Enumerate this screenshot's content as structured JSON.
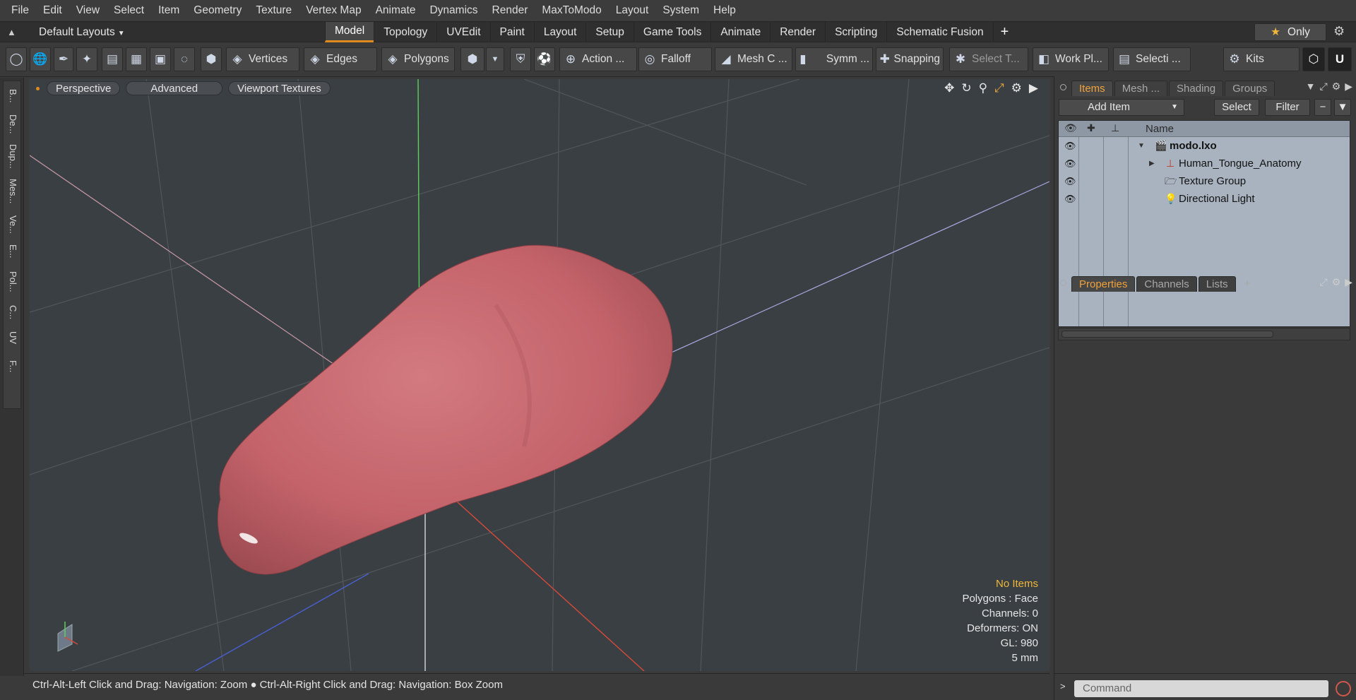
{
  "menu": [
    "File",
    "Edit",
    "View",
    "Select",
    "Item",
    "Geometry",
    "Texture",
    "Vertex Map",
    "Animate",
    "Dynamics",
    "Render",
    "MaxToModo",
    "Layout",
    "System",
    "Help"
  ],
  "layoutbar": {
    "layout_name": "Default Layouts",
    "tabs": [
      "Model",
      "Topology",
      "UVEdit",
      "Paint",
      "Layout",
      "Setup",
      "Game Tools",
      "Animate",
      "Render",
      "Scripting",
      "Schematic Fusion"
    ],
    "active_tab": "Model",
    "only_label": "Only"
  },
  "toolbar": {
    "vertices": "Vertices",
    "edges": "Edges",
    "polygons": "Polygons",
    "action": "Action ...",
    "falloff": "Falloff",
    "mesh_c": "Mesh C ...",
    "symm": "Symm ...",
    "snapping": "Snapping",
    "select_t": "Select T...",
    "work_pl": "Work Pl...",
    "selecti": "Selecti ...",
    "kits": "Kits"
  },
  "left_tabs": [
    "B...",
    "De...",
    "Dup...",
    "Mes...",
    "Ve...",
    "E...",
    "Pol...",
    "C...",
    "UV",
    "F..."
  ],
  "viewport": {
    "perspective": "Perspective",
    "advanced": "Advanced",
    "textures": "Viewport Textures",
    "stats": {
      "selection": "No Items",
      "polygons": "Polygons : Face",
      "channels": "Channels: 0",
      "deformers": "Deformers: ON",
      "gl": "GL: 980",
      "scale": "5 mm"
    }
  },
  "status": "Ctrl-Alt-Left Click and Drag: Navigation: Zoom ● Ctrl-Alt-Right Click and Drag: Navigation: Box Zoom",
  "items_panel": {
    "tabs": [
      "Items",
      "Mesh ...",
      "Shading",
      "Groups"
    ],
    "active": "Items",
    "add_item": "Add Item",
    "select": "Select",
    "filter": "Filter",
    "name_col": "Name",
    "rows": [
      {
        "label": "modo.lxo",
        "icon": "clapper-icon"
      },
      {
        "label": "Human_Tongue_Anatomy",
        "icon": "locator-icon"
      },
      {
        "label": "Texture Group",
        "icon": "folder-icon"
      },
      {
        "label": "Directional Light",
        "icon": "light-icon"
      }
    ]
  },
  "props_panel": {
    "tabs": [
      "Properties",
      "Channels",
      "Lists"
    ],
    "active": "Properties"
  },
  "command": {
    "placeholder": "Command"
  },
  "colors": {
    "accent": "#e08a1e",
    "highlight": "#f0b73a",
    "tongue": "#c7656a",
    "viewport_bg": "#3a3f43"
  }
}
